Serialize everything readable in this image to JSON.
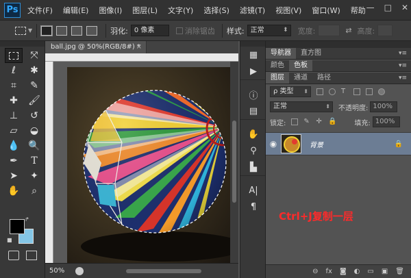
{
  "app": {
    "logo": "Ps",
    "menu": [
      "文件(F)",
      "编辑(E)",
      "图像(I)",
      "图层(L)",
      "文字(Y)",
      "选择(S)",
      "滤镜(T)",
      "视图(V)",
      "窗口(W)",
      "帮助"
    ],
    "window_controls": [
      "—",
      "□",
      "✕"
    ]
  },
  "options_bar": {
    "feather_label": "羽化:",
    "feather_value": "0 像素",
    "antialias_label": "消除锯齿",
    "style_label": "样式:",
    "style_value": "正常",
    "width_label": "宽度:",
    "height_label": "高度:"
  },
  "document": {
    "tab_title": "ball.jpg @ 50%(RGB/8#) *",
    "close": "×",
    "zoom": "50%"
  },
  "tools": {
    "icons": [
      "marquee-icon",
      "move-icon",
      "lasso-icon",
      "magic-wand-icon",
      "crop-icon",
      "eyedropper-icon",
      "healing-brush-icon",
      "brush-icon",
      "clone-stamp-icon",
      "history-brush-icon",
      "eraser-icon",
      "paint-bucket-icon",
      "blur-icon",
      "dodge-icon",
      "pen-icon",
      "type-icon",
      "path-selection-icon",
      "shape-icon",
      "hand-icon",
      "zoom-icon"
    ],
    "foreground_color": "#000000",
    "background_color": "#84c6e6"
  },
  "panels": {
    "top_tabs": [
      "导航器",
      "直方图"
    ],
    "color_tabs": [
      "颜色",
      "色板"
    ],
    "layer_tabs": [
      "图层",
      "通道",
      "路径"
    ],
    "kind_filter": "ρ 类型",
    "blend_mode": "正常",
    "opacity_label": "不透明度:",
    "opacity_value": "100%",
    "lock_label": "锁定:",
    "fill_label": "填充:",
    "fill_value": "100%",
    "layer_name": "背景",
    "footer_icons": [
      "link-icon",
      "fx-icon",
      "mask-icon",
      "adjustment-icon",
      "folder-icon",
      "new-layer-icon",
      "trash-icon"
    ],
    "footer_glyphs": [
      "⊖",
      "fx",
      "◙",
      "◐",
      "▭",
      "▣",
      "🗑"
    ]
  },
  "annotation": {
    "text": "Ctrl+J复制一层",
    "color": "#ff2a2a"
  }
}
